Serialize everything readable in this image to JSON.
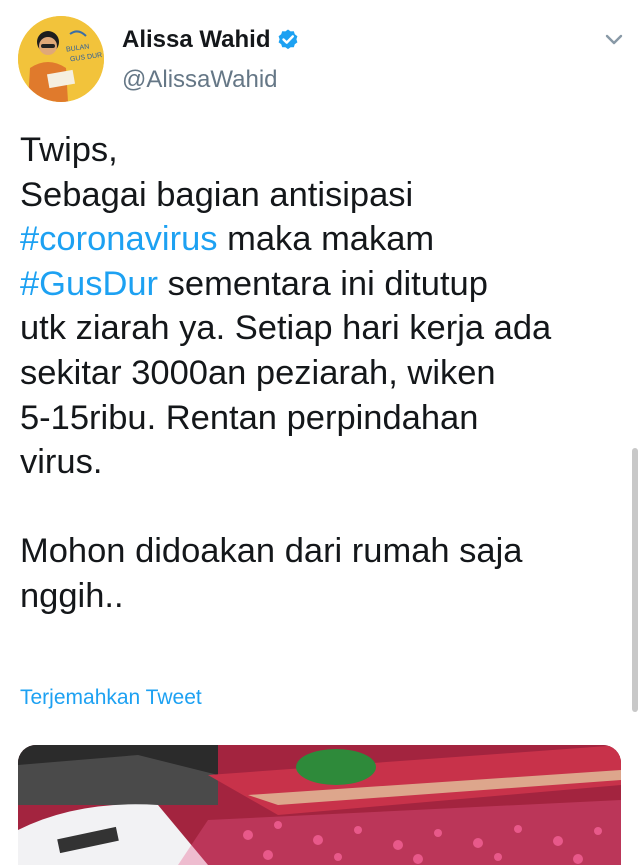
{
  "author": {
    "name": "Alissa Wahid",
    "handle": "@AlissaWahid",
    "avatar_icon": "profile-avatar-gusdur",
    "avatar_text": "BULAN GUS DUR",
    "verified_icon": "verified-badge-icon",
    "verified_color": "#1da1f2"
  },
  "tweet": {
    "lines": [
      [
        {
          "t": "Twips,"
        }
      ],
      [
        {
          "t": "Sebagai bagian antisipasi"
        }
      ],
      [
        {
          "t": "#coronavirus",
          "h": true
        },
        {
          "t": " maka makam"
        }
      ],
      [
        {
          "t": "#GusDur",
          "h": true
        },
        {
          "t": " sementara ini ditutup"
        }
      ],
      [
        {
          "t": "utk ziarah ya. Setiap hari kerja ada"
        }
      ],
      [
        {
          "t": "sekitar 3000an peziarah, wiken"
        }
      ],
      [
        {
          "t": "5-15ribu. Rentan perpindahan"
        }
      ],
      [
        {
          "t": "virus."
        }
      ],
      [
        {
          "t": ""
        }
      ],
      [
        {
          "t": "Mohon didoakan dari rumah saja"
        }
      ],
      [
        {
          "t": "nggih.."
        }
      ]
    ],
    "translate_label": "Terjemahkan Tweet",
    "media_alt": "grave-covered-in-rose-petals-photo"
  },
  "colors": {
    "link": "#1da1f2",
    "text": "#14171a",
    "secondary": "#657786"
  },
  "icons": {
    "more_menu": "chevron-down-icon"
  }
}
